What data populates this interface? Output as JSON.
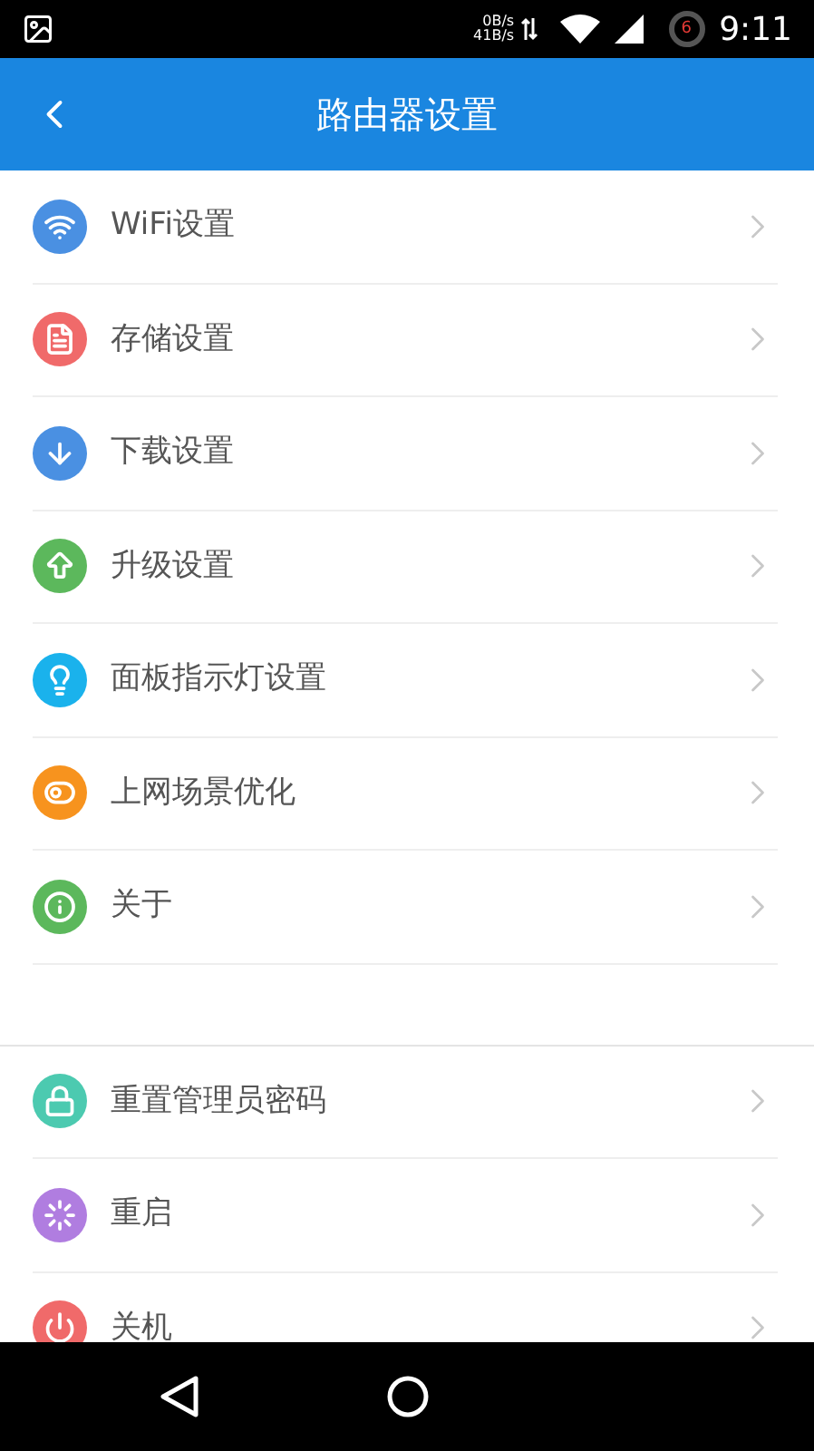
{
  "status_bar": {
    "speed_up": "0B/s",
    "speed_down": "41B/s",
    "badge": "6",
    "time": "9:11"
  },
  "header": {
    "title": "路由器设置"
  },
  "sections": [
    {
      "items": [
        {
          "label": "WiFi设置",
          "kind": "wifi",
          "color": "#4a90e2"
        },
        {
          "label": "存储设置",
          "kind": "storage",
          "color": "#f06a6a"
        },
        {
          "label": "下载设置",
          "kind": "download",
          "color": "#4a90e2"
        },
        {
          "label": "升级设置",
          "kind": "upgrade",
          "color": "#5cb85c"
        },
        {
          "label": "面板指示灯设置",
          "kind": "panel",
          "color": "#1ab2ec"
        },
        {
          "label": "上网场景优化",
          "kind": "scene",
          "color": "#f7931e"
        },
        {
          "label": "关于",
          "kind": "about",
          "color": "#5cb85c"
        }
      ]
    },
    {
      "items": [
        {
          "label": "重置管理员密码",
          "kind": "lock",
          "color": "#4ccab0"
        },
        {
          "label": "重启",
          "kind": "reboot",
          "color": "#b07de0"
        },
        {
          "label": "关机",
          "kind": "power",
          "color": "#f06a6a"
        }
      ]
    }
  ]
}
